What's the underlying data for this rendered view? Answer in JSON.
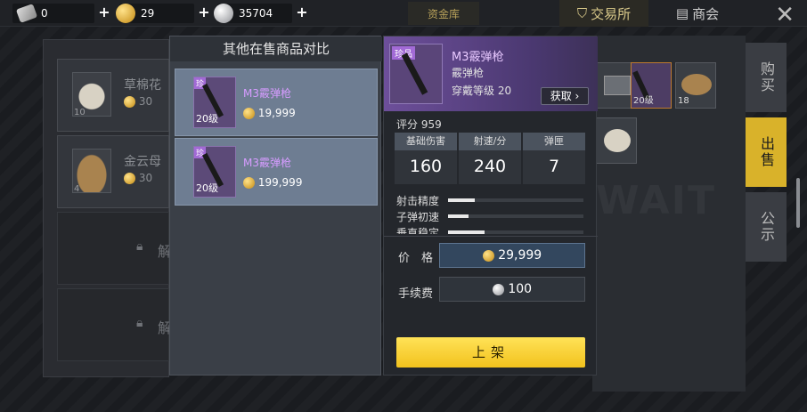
{
  "topbar": {
    "currencies": [
      {
        "name": "voucher",
        "value": "0"
      },
      {
        "name": "gold",
        "value": "29"
      },
      {
        "name": "silver",
        "value": "35704"
      }
    ],
    "vault_label": "资金库",
    "exchange_label": "交易所",
    "shop_label": "商会"
  },
  "background_list": [
    {
      "name": "草棉花",
      "count": "10",
      "price": "30"
    },
    {
      "name": "金云母",
      "count": "4",
      "price": "30"
    }
  ],
  "locked_label": "解",
  "side_tabs": [
    "购买",
    "出售",
    "公示"
  ],
  "compare": {
    "title": "其他在售商品对比",
    "rows": [
      {
        "tag": "珍",
        "level": "20级",
        "name": "M3霰弹枪",
        "price": "19,999"
      },
      {
        "tag": "珍",
        "level": "20级",
        "name": "M3霰弹枪",
        "price": "199,999"
      }
    ]
  },
  "detail": {
    "tag": "珍品",
    "name": "M3霰弹枪",
    "type": "霰弹枪",
    "req_label": "穿戴等级 20",
    "get_label": "获取 ›",
    "score": "评分 959",
    "stats": [
      {
        "label": "基础伤害",
        "value": "160"
      },
      {
        "label": "射速/分",
        "value": "240"
      },
      {
        "label": "弹匣",
        "value": "7"
      }
    ],
    "attrs": [
      {
        "label": "射击精度",
        "fill": 0.2
      },
      {
        "label": "子弹初速",
        "fill": 0.15
      },
      {
        "label": "垂直稳定",
        "fill": 0.27
      }
    ],
    "price_label": "价　格",
    "price_value": "29,999",
    "fee_label": "手续费",
    "fee_value": "100",
    "shelve_label": "上架"
  },
  "right_cells": [
    "20级",
    "18"
  ],
  "watermark": "WAIT"
}
